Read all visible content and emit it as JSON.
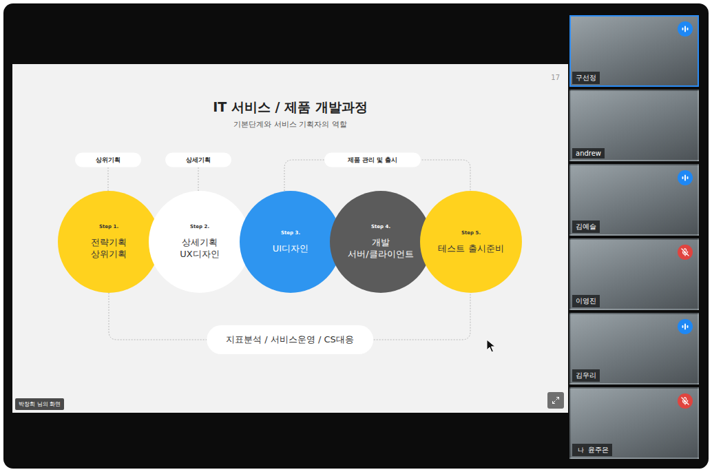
{
  "shared_screen": {
    "owner_label": "박창희 님의 화면",
    "slide": {
      "page": "17",
      "title": "IT 서비스 / 제품 개발과정",
      "subtitle": "기본단계와 서비스 기획자의 역할",
      "phase_labels": [
        "상위기획",
        "상세기획",
        "제품 관리 및 출시"
      ],
      "steps": [
        {
          "step": "Step 1.",
          "lines": [
            "전략기획",
            "상위기획"
          ],
          "color": "#ffd21e"
        },
        {
          "step": "Step 2.",
          "lines": [
            "상세기획",
            "UX디자인"
          ],
          "color": "#ffffff"
        },
        {
          "step": "Step 3.",
          "lines": [
            "UI디자인"
          ],
          "color": "#2e95f0"
        },
        {
          "step": "Step 4.",
          "lines": [
            "개발",
            "서버/클라이언트"
          ],
          "color": "#5b5b5b"
        },
        {
          "step": "Step 5.",
          "lines": [
            "테스트 출시준비"
          ],
          "color": "#ffd21e"
        }
      ],
      "footer": "지표분석 / 서비스운영 / CS대응"
    }
  },
  "participants": [
    {
      "name": "구선정",
      "audio": "speaking",
      "selected": true,
      "tag": ""
    },
    {
      "name": "andrew",
      "audio": "none",
      "selected": false,
      "tag": ""
    },
    {
      "name": "김예슬",
      "audio": "speaking",
      "selected": false,
      "tag": ""
    },
    {
      "name": "이영진",
      "audio": "muted",
      "selected": false,
      "tag": ""
    },
    {
      "name": "김우리",
      "audio": "speaking",
      "selected": false,
      "tag": ""
    },
    {
      "name": "윤주은",
      "audio": "muted",
      "selected": false,
      "tag": "나"
    }
  ]
}
